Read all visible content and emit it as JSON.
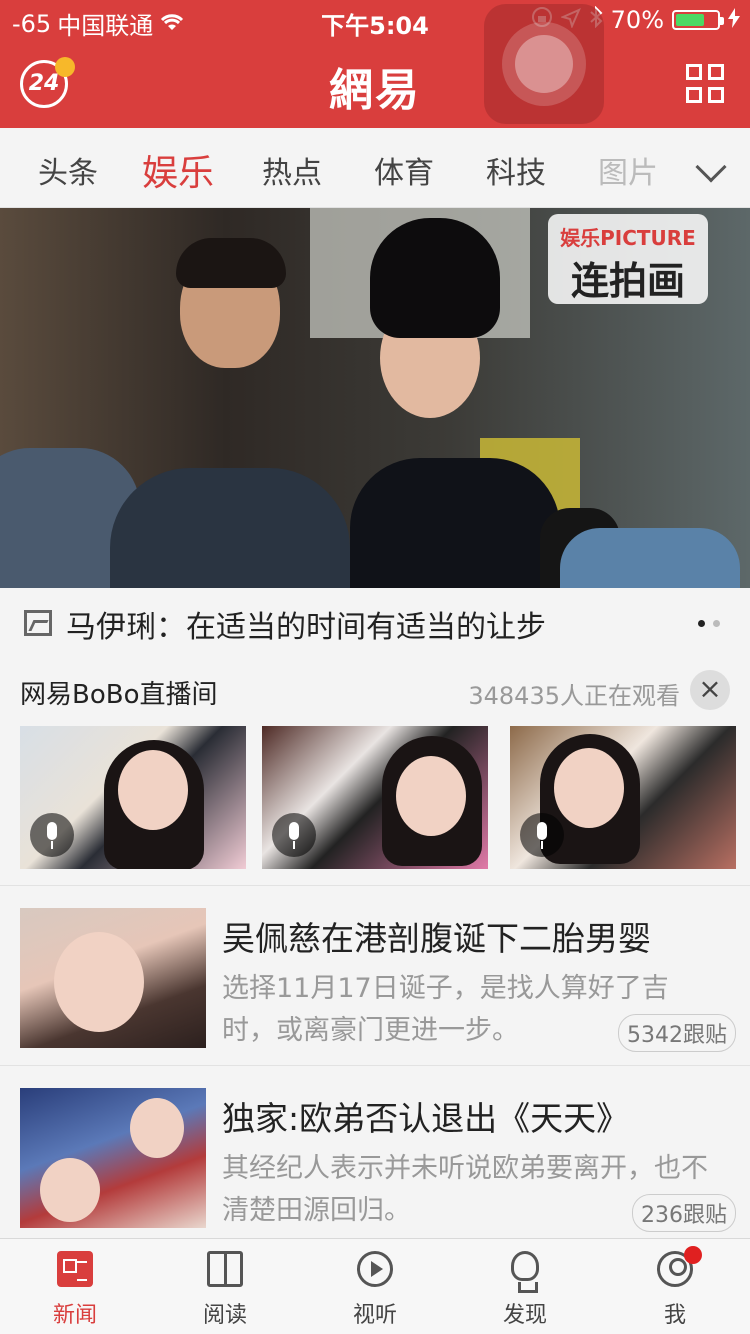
{
  "status": {
    "signal": "-65",
    "carrier": "中国联通",
    "time": "下午5:04",
    "battery_pct": "70%",
    "battery_level": 0.7
  },
  "header": {
    "badge": "24",
    "logo": "網易"
  },
  "tabs": [
    {
      "label": "头条"
    },
    {
      "label": "娱乐",
      "active": true
    },
    {
      "label": "热点"
    },
    {
      "label": "体育"
    },
    {
      "label": "科技"
    },
    {
      "label": "图片"
    }
  ],
  "hero": {
    "tag_top": "娱乐PICTURE",
    "tag_bottom": "连拍画",
    "caption": "马伊琍：在适当的时间有适当的让步"
  },
  "bobo": {
    "title": "网易BoBo直播间",
    "viewers": "348435人正在观看",
    "close": "×"
  },
  "articles": [
    {
      "title": "吴佩慈在港剖腹诞下二胎男婴",
      "desc": "选择11月17日诞子，是找人算好了吉时，或离豪门更进一步。",
      "count": "5342跟贴"
    },
    {
      "title": "独家:欧弟否认退出《天天》",
      "desc": "其经纪人表示并未听说欧弟要离开，也不清楚田源回归。",
      "count": "236跟贴"
    }
  ],
  "bottom_nav": [
    {
      "label": "新闻",
      "icon": "news-icon",
      "active": true
    },
    {
      "label": "阅读",
      "icon": "book-icon"
    },
    {
      "label": "视听",
      "icon": "play-icon"
    },
    {
      "label": "发现",
      "icon": "lightbulb-icon"
    },
    {
      "label": "我",
      "icon": "user-icon"
    }
  ],
  "colors": {
    "brand": "#d93e3d",
    "battery": "#4cd964"
  }
}
